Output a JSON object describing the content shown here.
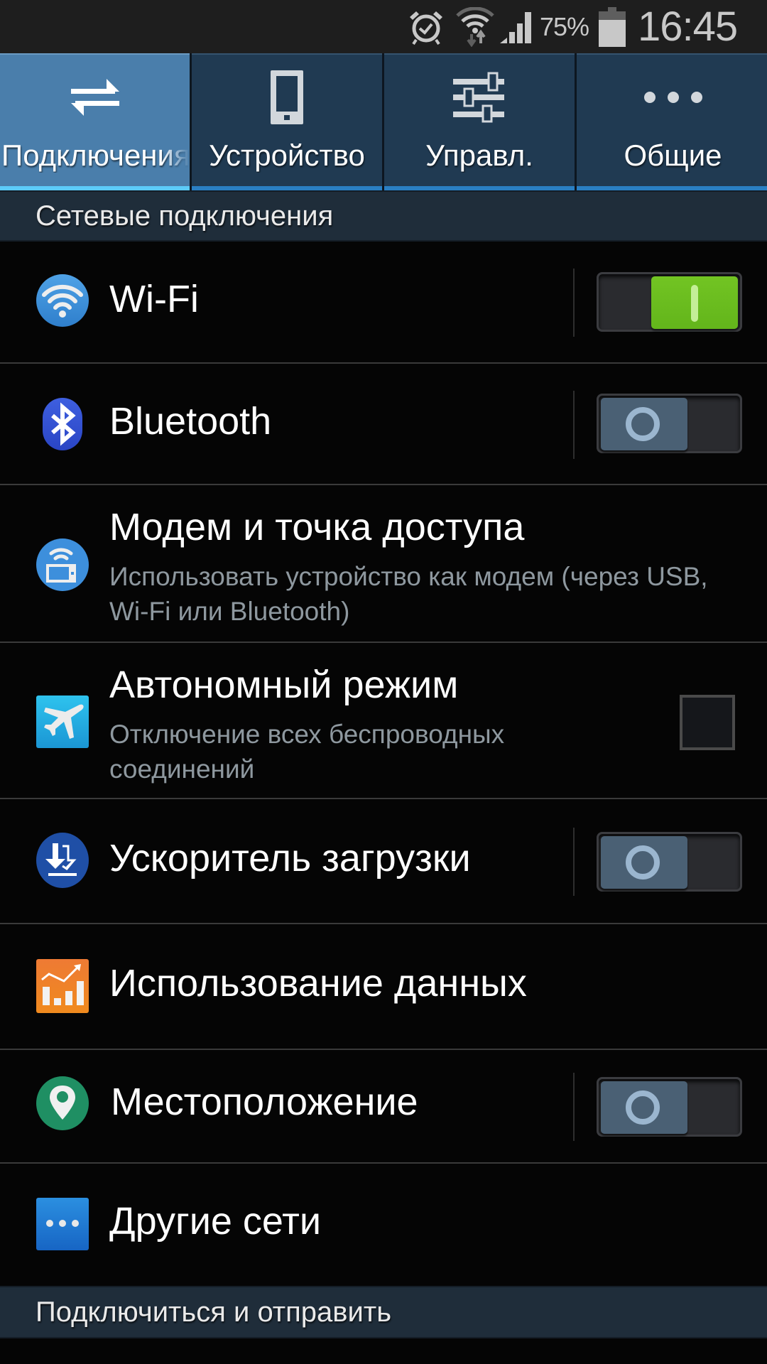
{
  "status_bar": {
    "icons": [
      "alarm-icon",
      "wifi-data-icon",
      "signal-icon",
      "battery-icon"
    ],
    "battery_percent": "75%",
    "time": "16:45"
  },
  "tabs": [
    {
      "label": "Подключения",
      "icon": "connections-icon",
      "active": true
    },
    {
      "label": "Устройство",
      "icon": "device-icon",
      "active": false
    },
    {
      "label": "Управл.",
      "icon": "controls-sliders-icon",
      "active": false
    },
    {
      "label": "Общие",
      "icon": "more-dots-icon",
      "active": false
    }
  ],
  "sections": [
    {
      "title": "Сетевые подключения"
    },
    {
      "title": "Подключиться и отправить"
    }
  ],
  "rows": [
    {
      "title": "Wi-Fi",
      "icon": "wifi-icon",
      "control": "switch",
      "state": "on"
    },
    {
      "title": "Bluetooth",
      "icon": "bluetooth-icon",
      "control": "switch",
      "state": "off"
    },
    {
      "title": "Модем и точка доступа",
      "subtitle": "Использовать устройство как модем (через USB, Wi-Fi или Bluetooth)",
      "icon": "tethering-hotspot-icon"
    },
    {
      "title": "Автономный режим",
      "subtitle": "Отключение всех беспроводных соединений",
      "icon": "airplane-icon",
      "control": "checkbox",
      "state": "unchecked"
    },
    {
      "title": "Ускоритель загрузки",
      "icon": "download-booster-icon",
      "control": "switch",
      "state": "off"
    },
    {
      "title": "Использование данных",
      "icon": "data-usage-icon"
    },
    {
      "title": "Местоположение",
      "icon": "location-pin-icon",
      "control": "switch",
      "state": "off"
    },
    {
      "title": "Другие сети",
      "icon": "more-networks-icon"
    }
  ],
  "colors": {
    "tab_active_bg": "#4a7eab",
    "tab_inactive_bg": "#203a52",
    "tab_active_indicator": "#5ccbf9",
    "tab_inactive_indicator": "#2a7fc3",
    "switch_on": "#6cbd1f",
    "switch_off_thumb": "#4a6074",
    "section_header_bg": "#1f2d3a"
  }
}
